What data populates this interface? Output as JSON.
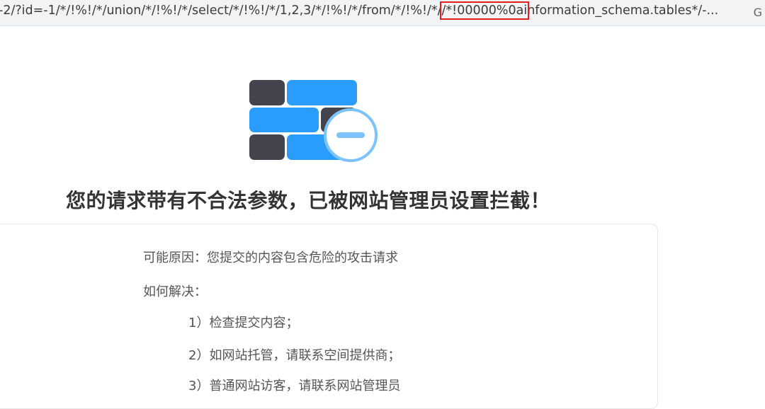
{
  "address_bar": {
    "url_prefix": "-2/?id=-1/*/!%!/*/union/*/!%!/*/select/*/!%!/*/1,2,3/*/!%!/*/from/*/!%!/*/",
    "url_highlighted": "/*!00000%0ai",
    "url_suffix": "nformation_schema.tables*/-...",
    "right_glyph": "G",
    "highlight_color": "#e02020"
  },
  "page": {
    "heading": "您的请求带有不合法参数，已被网站管理员设置拦截！",
    "reason": "可能原因：您提交的内容包含危险的攻击请求",
    "howto": "如何解决：",
    "steps": [
      "1）检查提交内容；",
      "2）如网站托管，请联系空间提供商；",
      "3）普通网站访客，请联系网站管理员"
    ]
  },
  "icons": {
    "logo": "firewall-brick-wall-blocked-icon"
  },
  "colors": {
    "brick_blue": "#2a9dfc",
    "brick_dark": "#44444f",
    "badge_ring": "#7cc3fb",
    "heading": "#333333",
    "body_text": "#555555"
  }
}
